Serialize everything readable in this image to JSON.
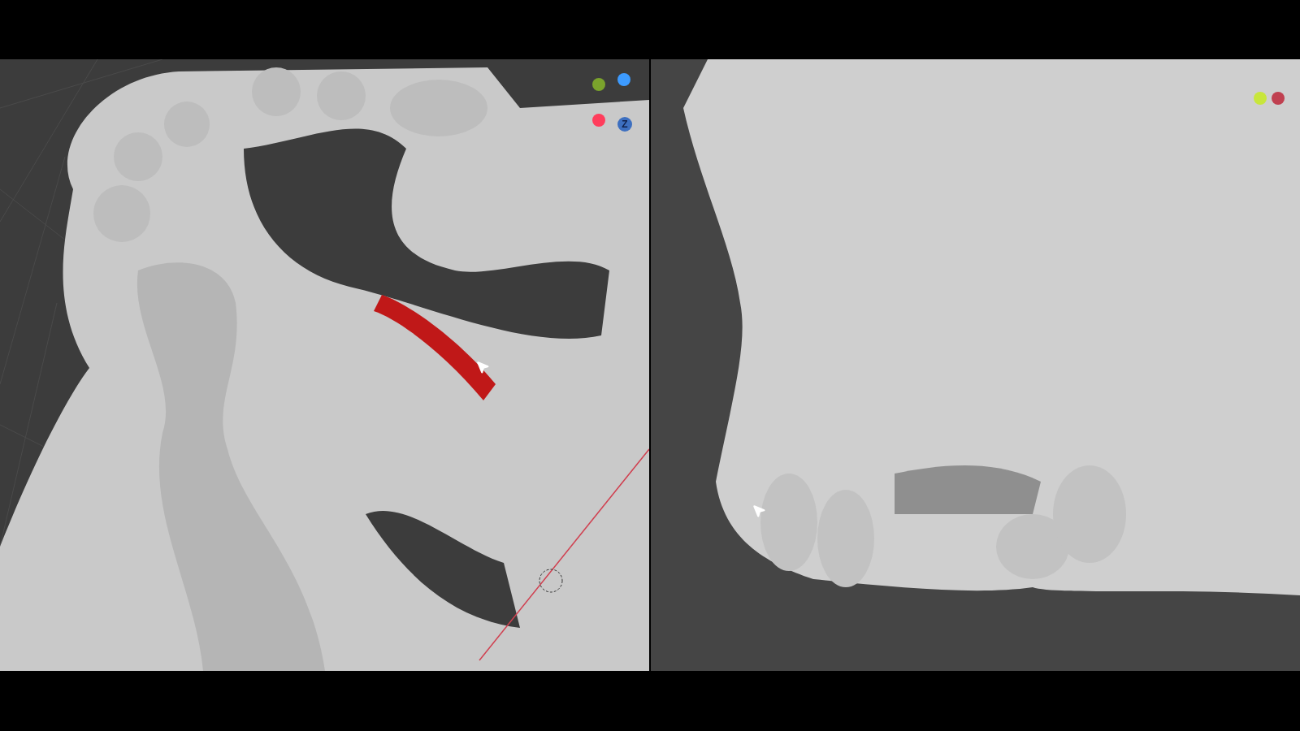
{
  "left_viewport": {
    "axis_gizmo": {
      "label": "Z"
    }
  }
}
